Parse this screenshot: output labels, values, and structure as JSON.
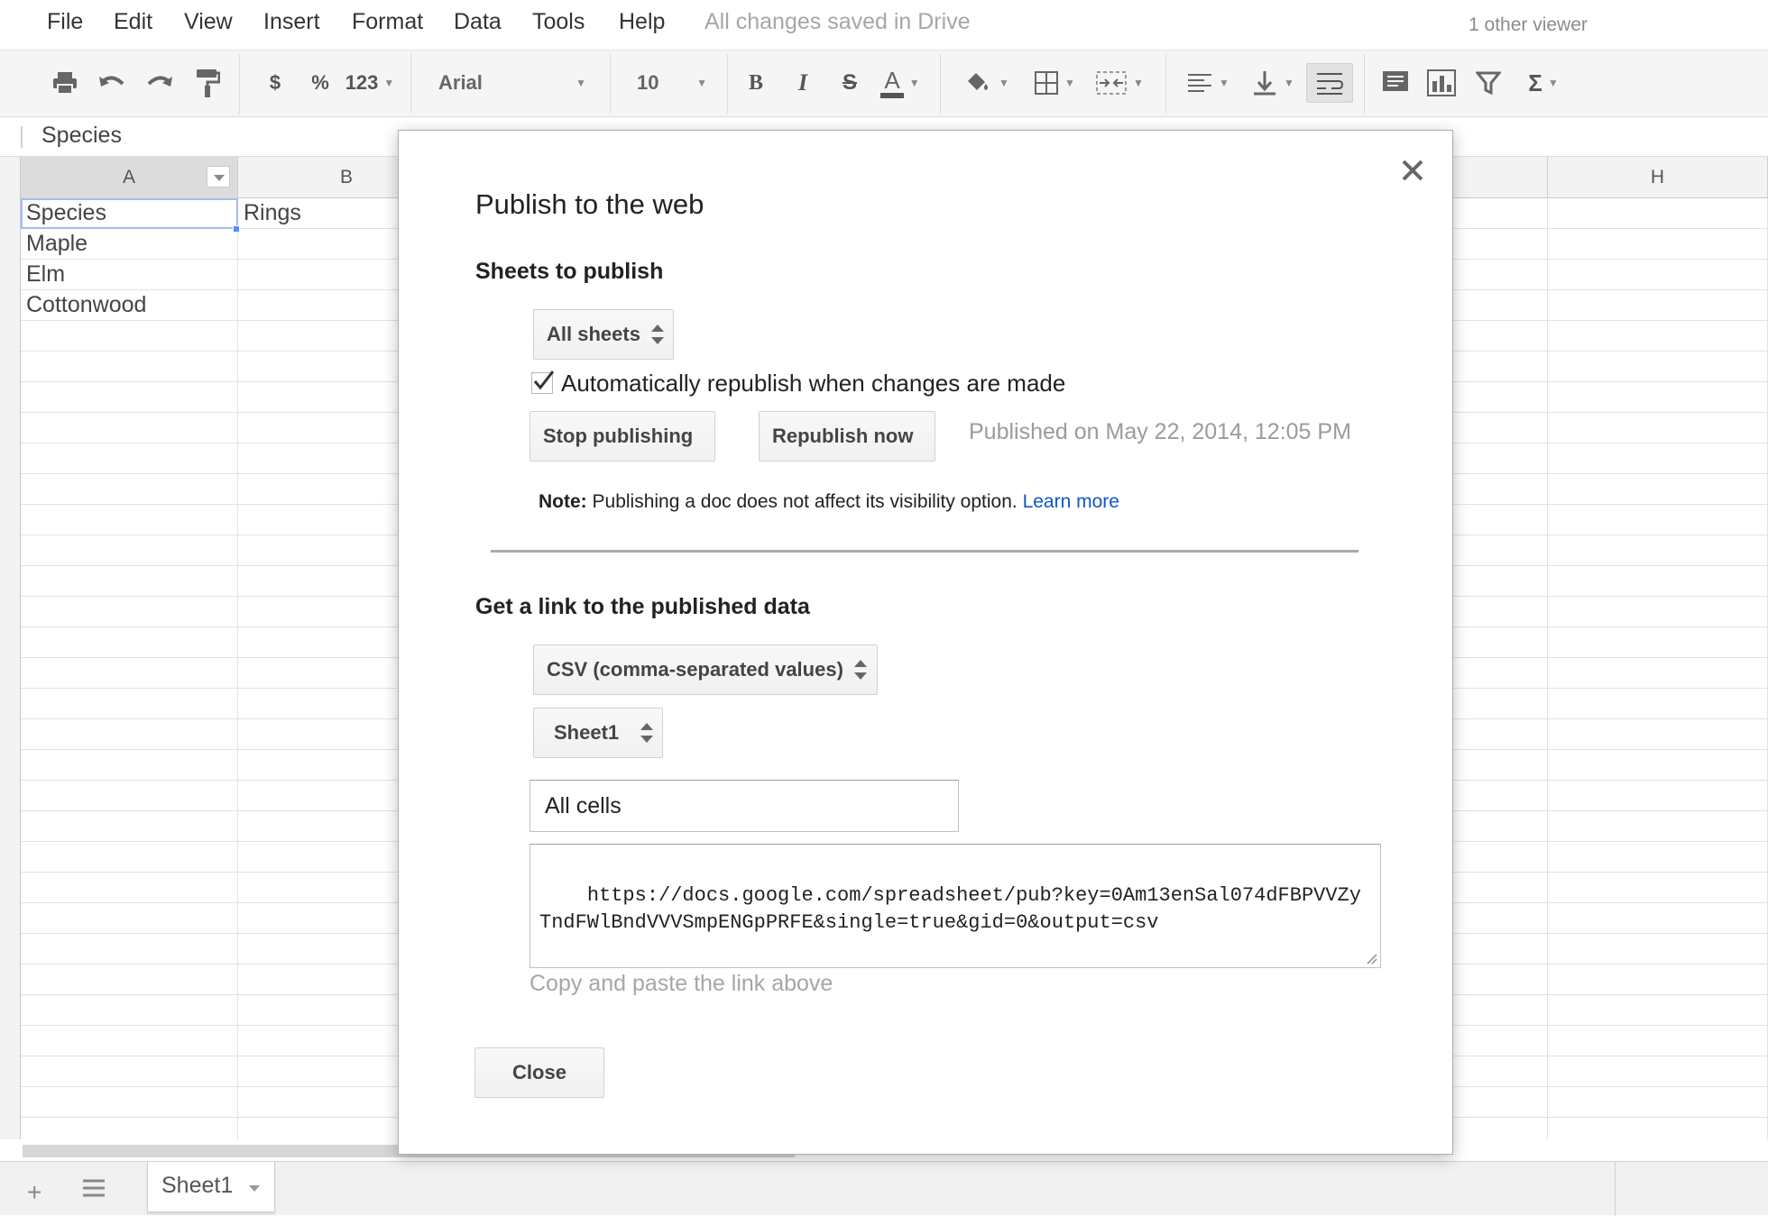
{
  "menu": {
    "items": [
      "File",
      "Edit",
      "View",
      "Insert",
      "Format",
      "Data",
      "Tools",
      "Help"
    ],
    "save_status": "All changes saved in Drive",
    "viewers": "1 other viewer"
  },
  "toolbar": {
    "currency": "$",
    "percent": "%",
    "more_formats": "123",
    "font": "Arial",
    "font_size": "10",
    "bold": "B",
    "italic": "I",
    "strike": "S",
    "text_color": "A",
    "functions": "Σ"
  },
  "formula_bar": {
    "value": "Species"
  },
  "grid": {
    "columns": [
      "A",
      "B",
      "H"
    ],
    "rows": [
      [
        "Species",
        "Rings"
      ],
      [
        "Maple",
        ""
      ],
      [
        "Elm",
        ""
      ],
      [
        "Cottonwood",
        ""
      ]
    ]
  },
  "sheets": {
    "active": "Sheet1"
  },
  "dialog": {
    "title": "Publish to the web",
    "sheets_section": "Sheets to publish",
    "sheets_select": "All sheets",
    "auto_republish_label": "Automatically republish when changes are made",
    "auto_republish_checked": true,
    "stop_button": "Stop publishing",
    "republish_button": "Republish now",
    "published_status": "Published on May 22, 2014, 12:05 PM",
    "note_label": "Note:",
    "note_text": "Publishing a doc does not affect its visibility option.",
    "learn_more": "Learn more",
    "link_section": "Get a link to the published data",
    "format_select": "CSV (comma-separated values)",
    "sheet_select": "Sheet1",
    "range_value": "All cells",
    "link_value": "https://docs.google.com/spreadsheet/pub?key=0Am13enSal074dFBPVVZyTndFWlBndVVVSmpENGpPRFE&single=true&gid=0&output=csv",
    "link_hint": "Copy and paste the link above",
    "close_button": "Close"
  },
  "colors": {
    "link": "#1155cc",
    "selection": "#a4bdf2",
    "muted_text": "#9b9b9b"
  }
}
